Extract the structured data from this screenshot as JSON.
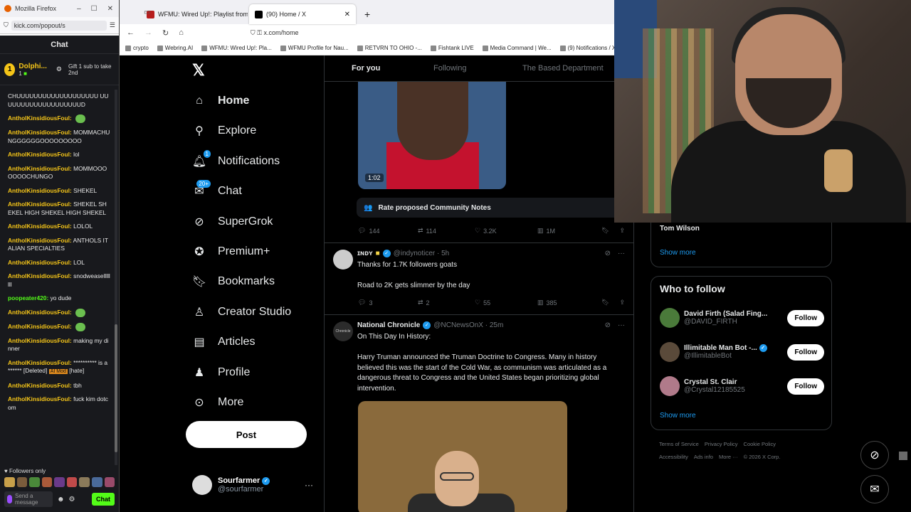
{
  "kick": {
    "tab_title": "Mozilla Firefox",
    "url": "kick.com/popout/s",
    "chat_header": "Chat",
    "pinned": {
      "badge": "1",
      "name": "Dolphi...",
      "sub": "1",
      "gift": "Gift 1 sub to take 2nd"
    },
    "messages": [
      {
        "user": "",
        "text": "CHUUUUUUUUUUUUUUUUUUU UUUUUUUUUUUUUUUUUUUD",
        "emote": false
      },
      {
        "user": "AntholKinsidiousFoul:",
        "text": "",
        "emote": true
      },
      {
        "user": "AntholKinsidiousFoul:",
        "text": "MOMMACHUNGGGGGGOOOOOOOOO",
        "emote": false
      },
      {
        "user": "AntholKinsidiousFoul:",
        "text": "lol",
        "emote": false
      },
      {
        "user": "AntholKinsidiousFoul:",
        "text": "MOMMOOOOOOOCHUNGO",
        "emote": false
      },
      {
        "user": "AntholKinsidiousFoul:",
        "text": "SHEKEL",
        "emote": false
      },
      {
        "user": "AntholKinsidiousFoul:",
        "text": "SHEKEL SHEKEL HIGH SHEKEL HIGH SHEKEL",
        "emote": false
      },
      {
        "user": "AntholKinsidiousFoul:",
        "text": "LOLOL",
        "emote": false
      },
      {
        "user": "AntholKinsidiousFoul:",
        "text": "ANTHOLS ITALIAN SPECIALTIES",
        "emote": false
      },
      {
        "user": "AntholKinsidiousFoul:",
        "text": "LOL",
        "emote": false
      },
      {
        "user": "AntholKinsidiousFoul:",
        "text": "snodweasellllllll",
        "emote": false
      },
      {
        "user": "poopeater420:",
        "text": "yo dude",
        "emote": false,
        "green": true
      },
      {
        "user": "AntholKinsidiousFoul:",
        "text": "",
        "emote": true
      },
      {
        "user": "AntholKinsidiousFoul:",
        "text": "",
        "emote": true
      },
      {
        "user": "AntholKinsidiousFoul:",
        "text": "making my dinner",
        "emote": false
      },
      {
        "user": "AntholKinsidiousFoul:",
        "text": "********** is a ****** [Deleted]",
        "mod": "AI Mod",
        "tail": "[hate]",
        "emote": false
      },
      {
        "user": "AntholKinsidiousFoul:",
        "text": "tbh",
        "emote": false
      },
      {
        "user": "AntholKinsidiousFoul:",
        "text": "fuck kim dotcom",
        "emote": false
      }
    ],
    "followers_only": "Followers only",
    "send_placeholder": "Send a message",
    "chat_button": "Chat"
  },
  "browser": {
    "tabs": [
      {
        "title": "WFMU: Wired Up!: Playlist from",
        "active": false
      },
      {
        "title": "(90) Home / X",
        "active": true
      }
    ],
    "url": "x.com/home",
    "bookmarks": [
      "crypto",
      "Webring.AI",
      "WFMU: Wired Up!: Pla...",
      "WFMU Profile for Nau...",
      "RETVRN TO OHIO -...",
      "Fishtank LIVE",
      "Media Command | We...",
      "(9) Notifications / X"
    ]
  },
  "x": {
    "nav": [
      {
        "key": "home",
        "label": "Home",
        "icon": "home-icon"
      },
      {
        "key": "explore",
        "label": "Explore",
        "icon": "search-icon"
      },
      {
        "key": "notifications",
        "label": "Notifications",
        "icon": "bell-icon",
        "badge": "1"
      },
      {
        "key": "chat",
        "label": "Chat",
        "icon": "mail-icon",
        "badge": "20+"
      },
      {
        "key": "supergrok",
        "label": "SuperGrok",
        "icon": "grok-icon"
      },
      {
        "key": "premium",
        "label": "Premium+",
        "icon": "premium-icon"
      },
      {
        "key": "bookmarks",
        "label": "Bookmarks",
        "icon": "bookmark-icon"
      },
      {
        "key": "creator",
        "label": "Creator Studio",
        "icon": "creator-icon"
      },
      {
        "key": "articles",
        "label": "Articles",
        "icon": "article-icon"
      },
      {
        "key": "profile",
        "label": "Profile",
        "icon": "person-icon"
      },
      {
        "key": "more",
        "label": "More",
        "icon": "more-circle-icon"
      }
    ],
    "post_button": "Post",
    "account": {
      "name": "Sourfarmer",
      "handle": "@sourfarmer"
    },
    "feed_tabs": [
      "For you",
      "Following",
      "The Based Department"
    ],
    "video_duration": "1:02",
    "community_notes": "Rate proposed Community Notes",
    "tweet0_actions": {
      "replies": "144",
      "reposts": "114",
      "likes": "3.2K",
      "views": "1M"
    },
    "tweet1": {
      "name": "ɪɴᴅʏ",
      "handle": "@indynoticer · 5h",
      "lines": [
        "Thanks for 1.7K followers goats",
        "Road to 2K gets slimmer by the day"
      ],
      "replies": "3",
      "reposts": "2",
      "likes": "55",
      "views": "385"
    },
    "tweet2": {
      "name": "National Chronicle",
      "handle": "@NCNewsOnX · 25m",
      "avatar_text": "Chronicle",
      "lines": [
        "On This Day In History:",
        "Harry Truman announced the Truman Doctrine to Congress. Many in history believed this was the start of the Cold War, as communism was articulated as a dangerous threat to Congress and the United States began prioritizing global intervention."
      ]
    },
    "trend_name": "Tom Wilson",
    "show_more": "Show more",
    "who_to_follow": "Who to follow",
    "follow_label": "Follow",
    "suggestions": [
      {
        "name": "David Firth (Salad Fing...",
        "handle": "@DAVID_FIRTH"
      },
      {
        "name": "Illimitable Man Bot -...",
        "handle": "@IllimitableBot"
      },
      {
        "name": "Crystal St. Clair",
        "handle": "@Crystal12185525"
      }
    ],
    "footer_links": [
      "Terms of Service",
      "Privacy Policy",
      "Cookie Policy",
      "Accessibility",
      "Ads info",
      "More ···",
      "© 2026 X Corp."
    ]
  }
}
